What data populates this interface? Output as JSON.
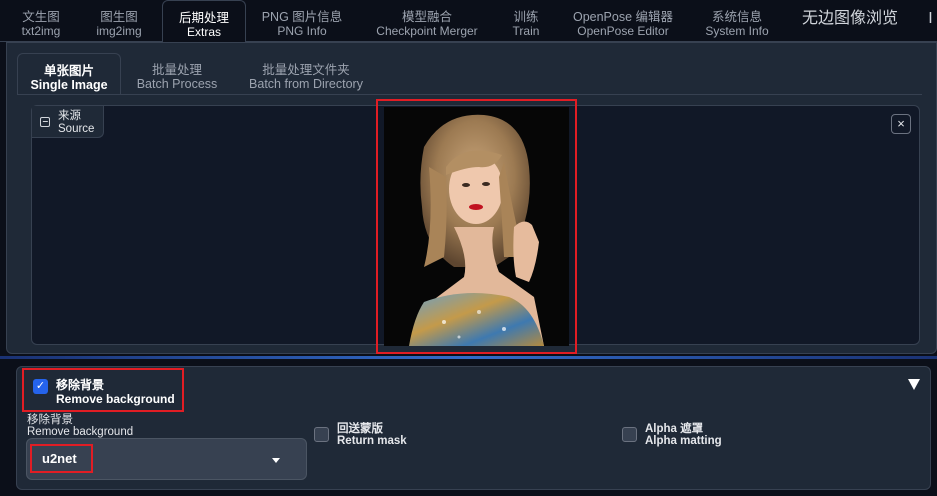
{
  "top_tabs": [
    {
      "line1": "文生图",
      "line2": "txt2img"
    },
    {
      "line1": "图生图",
      "line2": "img2img"
    },
    {
      "line1": "后期处理",
      "line2": "Extras"
    },
    {
      "line1": "PNG 图片信息",
      "line2": "PNG Info"
    },
    {
      "line1": "模型融合",
      "line2": "Checkpoint Merger"
    },
    {
      "line1": "训练",
      "line2": "Train"
    },
    {
      "line1": "OpenPose 编辑器",
      "line2": "OpenPose Editor"
    },
    {
      "line1": "系统信息",
      "line2": "System Info"
    },
    {
      "line1": "无边图像浏览",
      "line2": ""
    },
    {
      "line1": "I",
      "line2": ""
    }
  ],
  "sub_tabs": [
    {
      "line1": "单张图片",
      "line2": "Single Image"
    },
    {
      "line1": "批量处理",
      "line2": "Batch Process"
    },
    {
      "line1": "批量处理文件夹",
      "line2": "Batch from Directory"
    }
  ],
  "source": {
    "line1": "来源",
    "line2": "Source",
    "close": "×"
  },
  "remove_bg": {
    "checked": true,
    "check_mark": "✓",
    "title1": "移除背景",
    "title2": "Remove background",
    "model_label1": "移除背景",
    "model_label2": "Remove background",
    "model_value": "u2net",
    "return_mask1": "回送蒙版",
    "return_mask2": "Return mask",
    "alpha1": "Alpha 遮罩",
    "alpha2": "Alpha matting"
  },
  "colors": {
    "accent": "#2563eb",
    "highlight": "#e11d24",
    "background": "#0b0f19",
    "panel": "#1f2937"
  }
}
